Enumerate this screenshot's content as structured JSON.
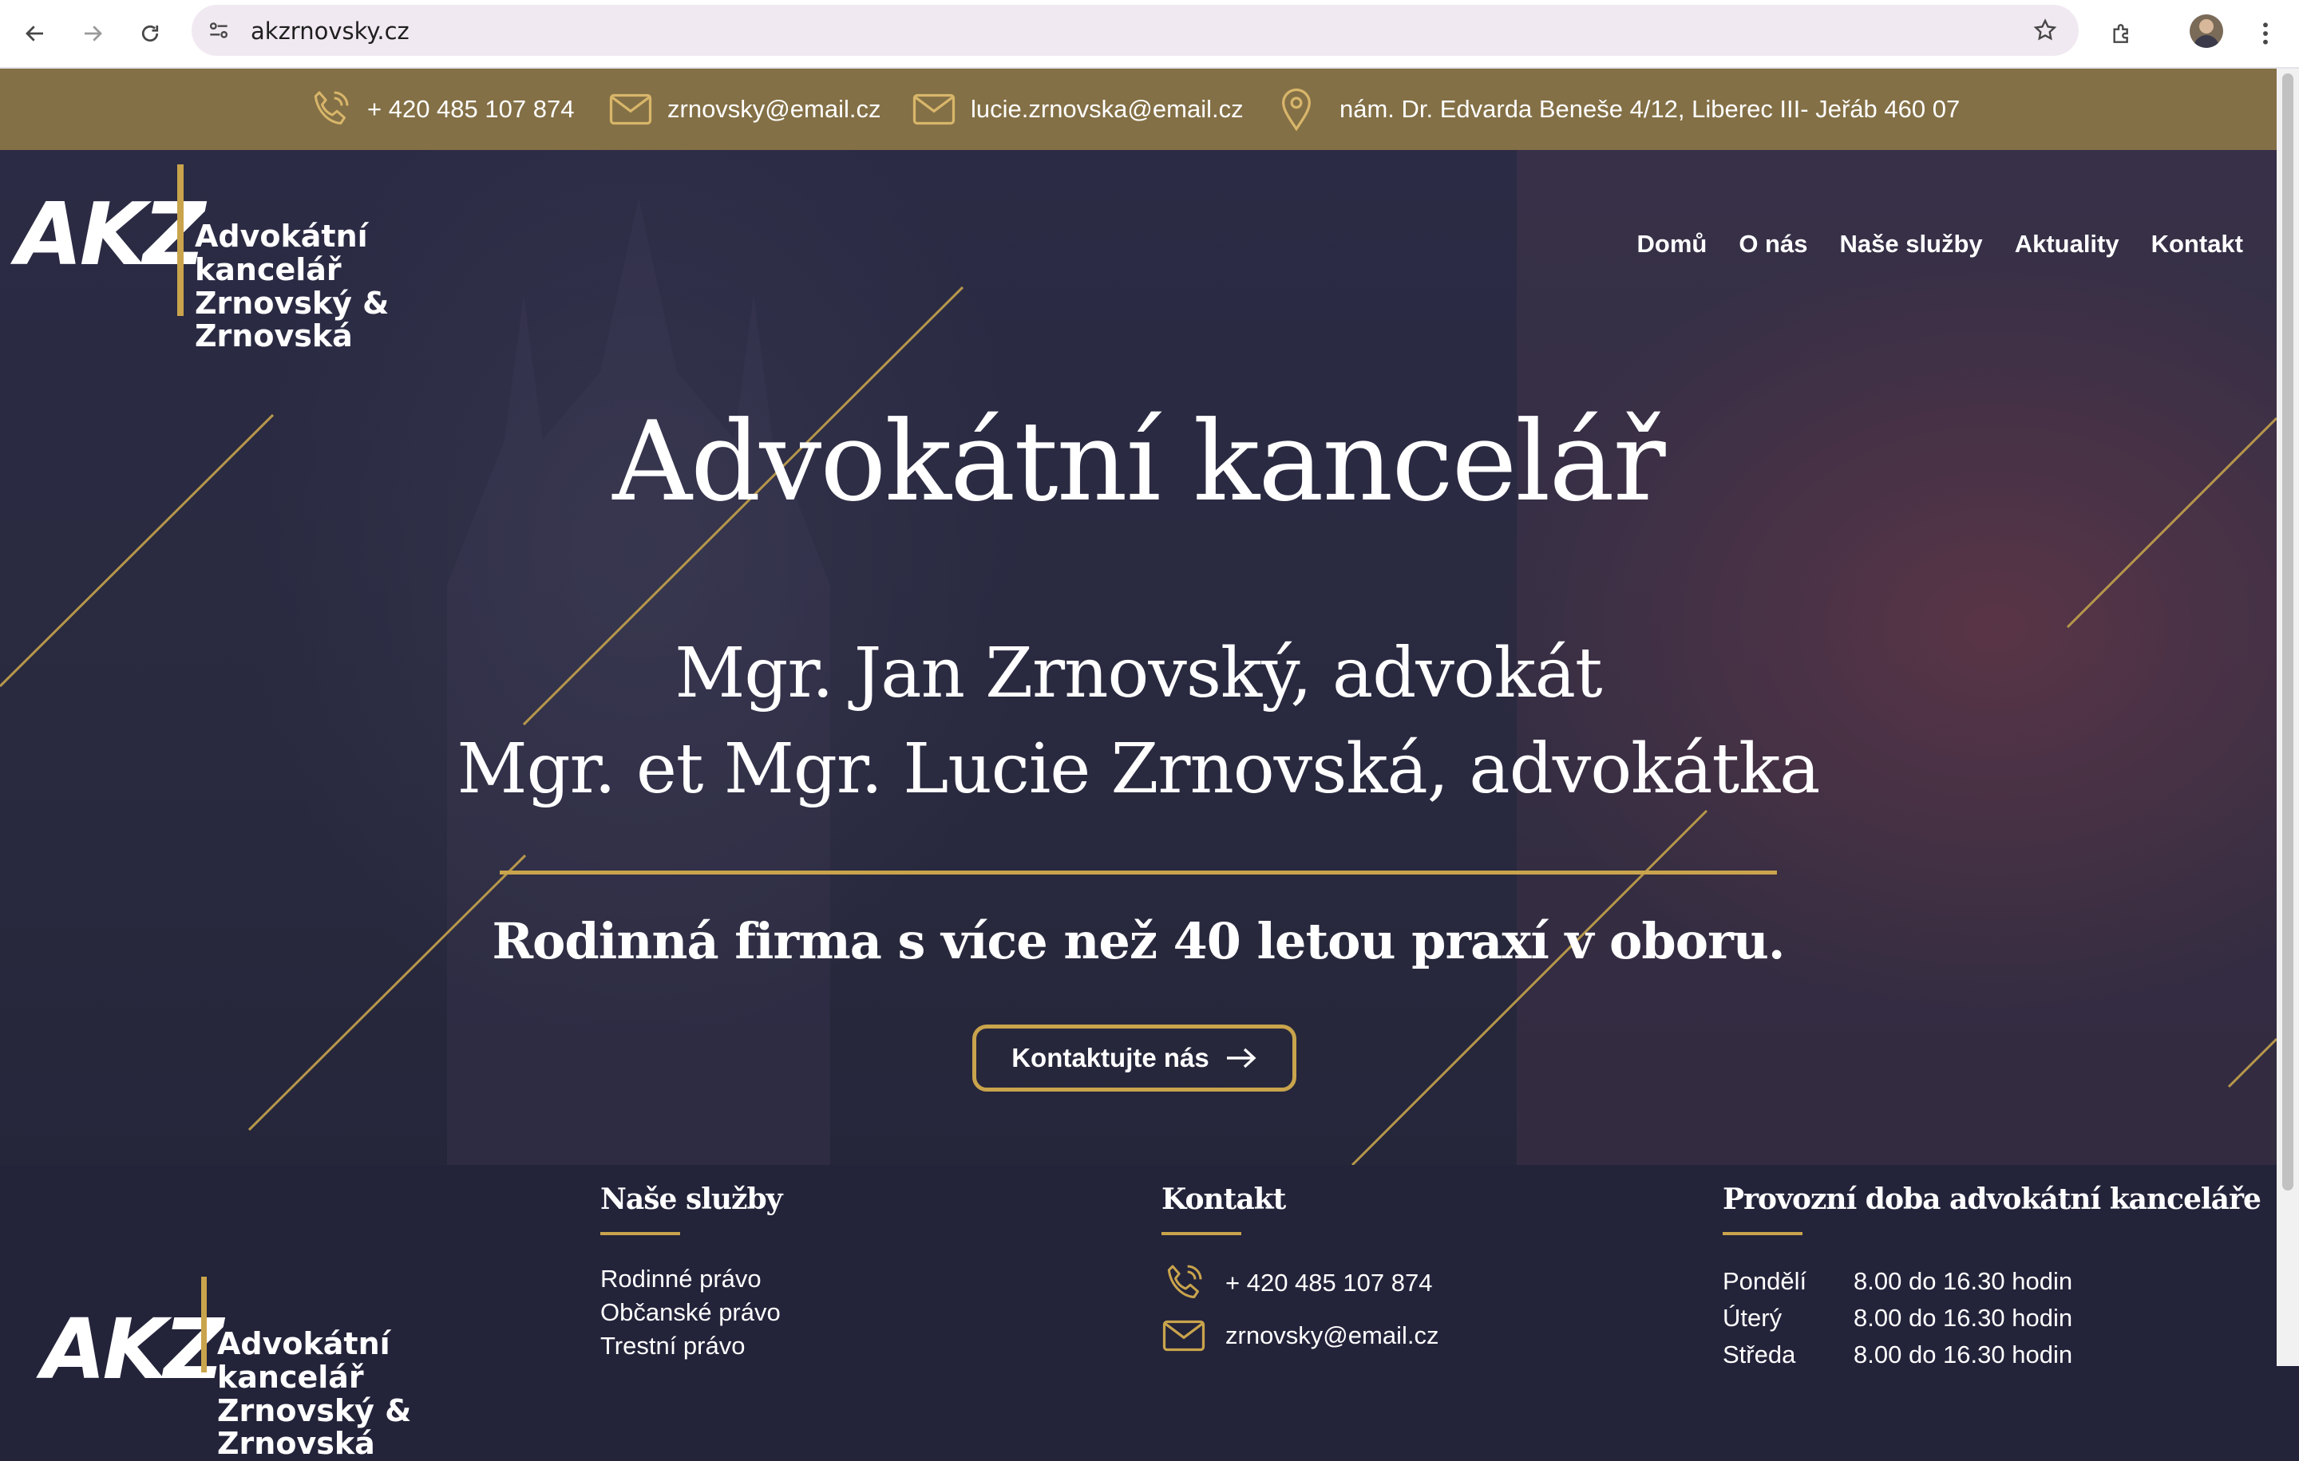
{
  "browser": {
    "url": "akzrnovsky.cz"
  },
  "topbar": {
    "phone": "+ 420 485 107 874",
    "email1": "zrnovsky@email.cz",
    "email2": "lucie.zrnovska@email.cz",
    "address": "nám. Dr. Edvarda Beneše 4/12, Liberec III- Jeřáb 460 07"
  },
  "logo": {
    "mark": "AKZ",
    "line1": "Advokátní kancelář",
    "line2": "Zrnovský & Zrnovská"
  },
  "nav": {
    "items": [
      "Domů",
      "O nás",
      "Naše služby",
      "Aktuality",
      "Kontakt"
    ]
  },
  "hero": {
    "title": "Advokátní kancelář",
    "line1": "Mgr. Jan Zrnovský, advokát",
    "line2": "Mgr. et Mgr. Lucie Zrnovská, advokátka",
    "tagline": "Rodinná firma s více než 40 letou praxí v oboru.",
    "cta": "Kontaktujte nás"
  },
  "footer": {
    "services_title": "Naše služby",
    "services": [
      "Rodinné právo",
      "Občanské právo",
      "Trestní právo"
    ],
    "contact_title": "Kontakt",
    "contact_phone": "+ 420 485 107 874",
    "contact_email": "zrnovsky@email.cz",
    "hours_title": "Provozní doba advokátní kanceláře",
    "hours": [
      {
        "day": "Pondělí",
        "time": "8.00 do 16.30 hodin"
      },
      {
        "day": "Úterý",
        "time": "8.00 do 16.30 hodin"
      },
      {
        "day": "Středa",
        "time": "8.00 do 16.30 hodin"
      }
    ]
  },
  "colors": {
    "gold": "#c9a44c",
    "topbar": "#847046",
    "navy": "#23233a"
  }
}
